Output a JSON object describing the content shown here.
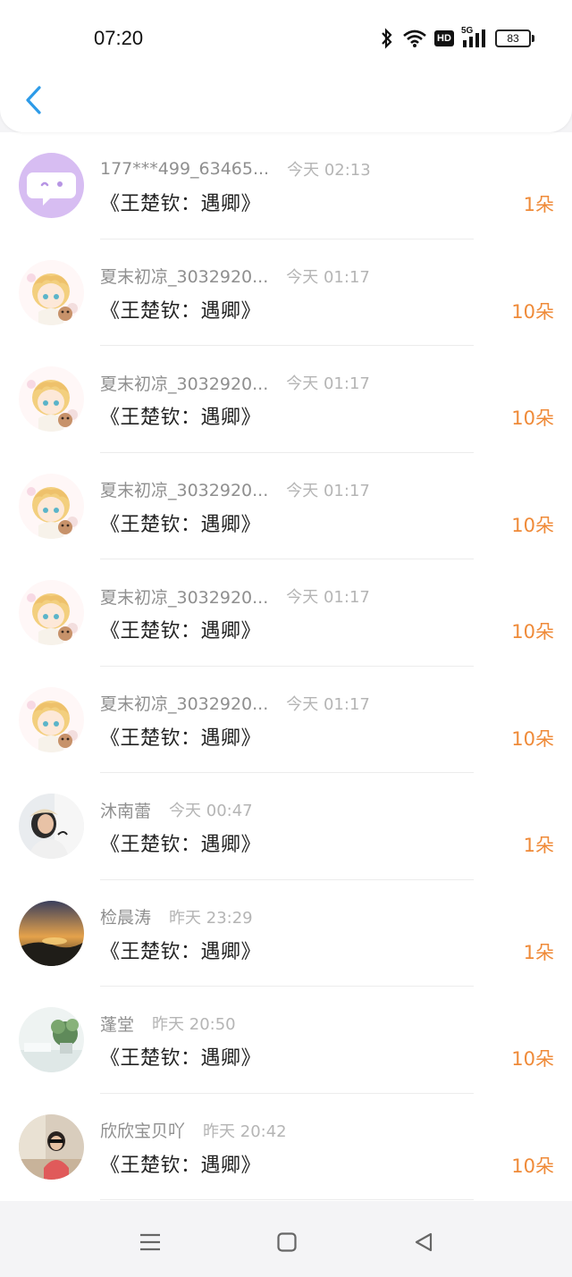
{
  "status_bar": {
    "time": "07:20",
    "battery": "83",
    "icons": [
      "bluetooth-icon",
      "wifi-icon",
      "hd-badge",
      "5g-signal-icon",
      "battery-icon"
    ],
    "hd_label": "HD",
    "network_label": "5G"
  },
  "header": {
    "back_icon": "chevron-left-icon",
    "accent_color": "#2d9be8"
  },
  "list": [
    {
      "username": "177***499_63465...",
      "time": "今天 02:13",
      "title": "《王楚钦：遇卿》",
      "count": "1朵",
      "avatar": "chat-bubble-avatar"
    },
    {
      "username": "夏末初凉_3032920...",
      "time": "今天 01:17",
      "title": "《王楚钦：遇卿》",
      "count": "10朵",
      "avatar": "anime-boy-avatar"
    },
    {
      "username": "夏末初凉_3032920...",
      "time": "今天 01:17",
      "title": "《王楚钦：遇卿》",
      "count": "10朵",
      "avatar": "anime-boy-avatar"
    },
    {
      "username": "夏末初凉_3032920...",
      "time": "今天 01:17",
      "title": "《王楚钦：遇卿》",
      "count": "10朵",
      "avatar": "anime-boy-avatar"
    },
    {
      "username": "夏末初凉_3032920...",
      "time": "今天 01:17",
      "title": "《王楚钦：遇卿》",
      "count": "10朵",
      "avatar": "anime-boy-avatar"
    },
    {
      "username": "夏末初凉_3032920...",
      "time": "今天 01:17",
      "title": "《王楚钦：遇卿》",
      "count": "10朵",
      "avatar": "anime-boy-avatar"
    },
    {
      "username": "沐南蕾",
      "time": "今天 00:47",
      "title": "《王楚钦：遇卿》",
      "count": "1朵",
      "avatar": "woman-photo-avatar"
    },
    {
      "username": "检晨涛",
      "time": "昨天 23:29",
      "title": "《王楚钦：遇卿》",
      "count": "1朵",
      "avatar": "sunset-photo-avatar"
    },
    {
      "username": "蓬堂",
      "time": "昨天 20:50",
      "title": "《王楚钦：遇卿》",
      "count": "10朵",
      "avatar": "plant-photo-avatar"
    },
    {
      "username": "欣欣宝贝吖",
      "time": "昨天 20:42",
      "title": "《王楚钦：遇卿》",
      "count": "10朵",
      "avatar": "child-photo-avatar"
    }
  ],
  "colors": {
    "count": "#ef8a38",
    "username": "#8f8f8f",
    "time": "#b5b5b5",
    "title": "#222222"
  },
  "navbar": {
    "icons": [
      "menu-icon",
      "home-square-icon",
      "back-triangle-icon"
    ]
  }
}
